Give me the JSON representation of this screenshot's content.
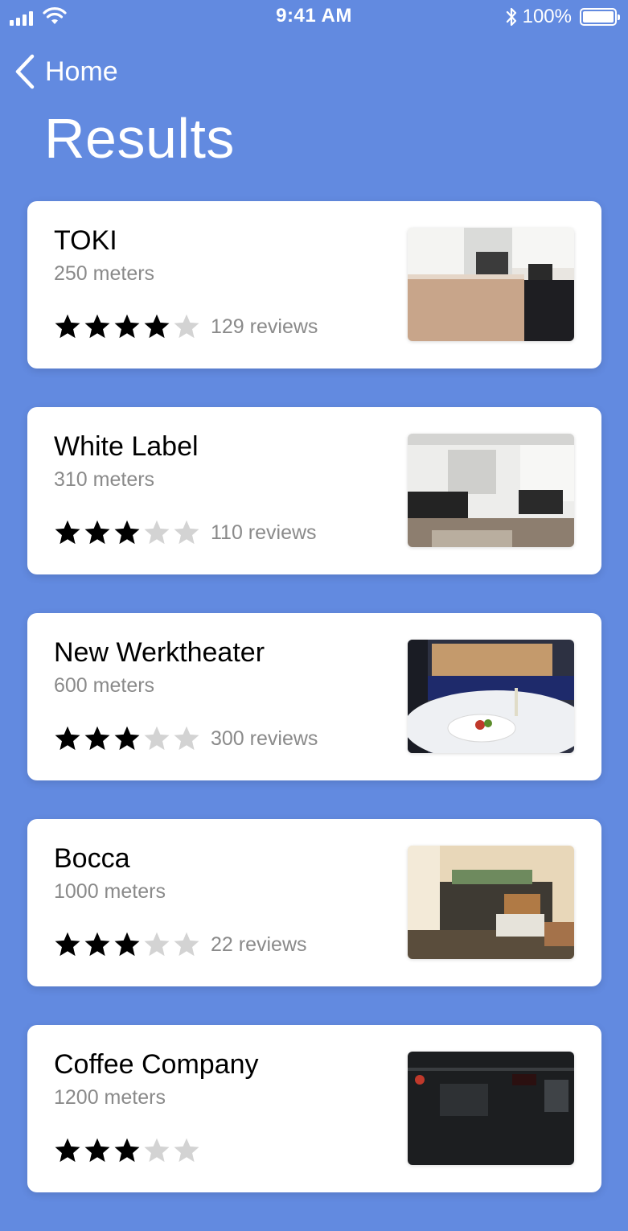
{
  "status_bar": {
    "time": "9:41 AM",
    "battery": "100%"
  },
  "nav": {
    "back_label": "Home",
    "title": "Results"
  },
  "results": [
    {
      "name": "TOKI",
      "distance": "250 meters",
      "rating": 4,
      "reviews": "129 reviews"
    },
    {
      "name": "White Label",
      "distance": "310 meters",
      "rating": 3,
      "reviews": "110 reviews"
    },
    {
      "name": "New Werktheater",
      "distance": "600 meters",
      "rating": 3,
      "reviews": "300 reviews"
    },
    {
      "name": "Bocca",
      "distance": "1000 meters",
      "rating": 3,
      "reviews": "22 reviews"
    },
    {
      "name": "Coffee Company",
      "distance": "1200 meters",
      "rating": 3,
      "reviews": ""
    }
  ],
  "colors": {
    "background": "#628AE0",
    "card": "#FFFFFF",
    "star_filled": "#000000",
    "star_empty": "#D3D3D3",
    "secondary_text": "#8A8A8A"
  }
}
